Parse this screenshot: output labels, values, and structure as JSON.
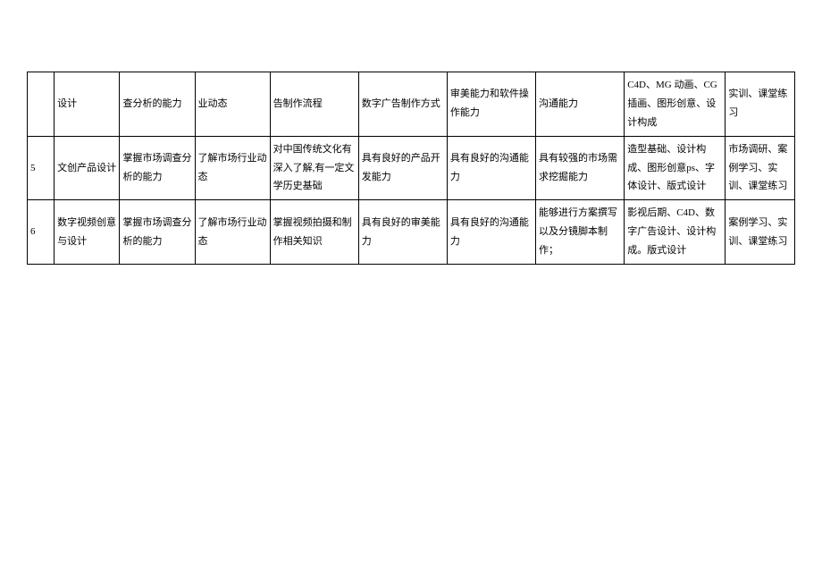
{
  "rows": [
    {
      "idx": "",
      "c1": "设计",
      "c2": "查分析的能力",
      "c3": "业动态",
      "c4": "告制作流程",
      "c5": "数字广告制作方式",
      "c6": "审美能力和软件操作能力",
      "c7": "沟通能力",
      "c8": "C4D、MG 动画、CG 插画、图形创意、设计构成",
      "c9": "实训、课堂练习"
    },
    {
      "idx": "5",
      "c1": "文创产品设计",
      "c2": "掌握市场调查分析的能力",
      "c3": "了解市场行业动态",
      "c4": "对中国传统文化有深入了解,有一定文学历史基础",
      "c5": "具有良好的产品开发能力",
      "c6": "具有良好的沟通能力",
      "c7": "具有较强的市场需求挖掘能力",
      "c8": "造型基础、设计构成、图形创意ps、字体设计、版式设计",
      "c9": "市场调研、案例学习、实训、课堂练习"
    },
    {
      "idx": "6",
      "c1": "数字视频创意与设计",
      "c2": "掌握市场调查分析的能力",
      "c3": "了解市场行业动态",
      "c4": "掌握视频拍摄和制作相关知识",
      "c5": "具有良好的审美能力",
      "c6": "具有良好的沟通能力",
      "c7": "能够进行方案撰写以及分镜脚本制作；",
      "c8": "影视后期、C4D、数字广告设计、设计构成。版式设计",
      "c9": "案例学习、实训、课堂练习"
    }
  ]
}
